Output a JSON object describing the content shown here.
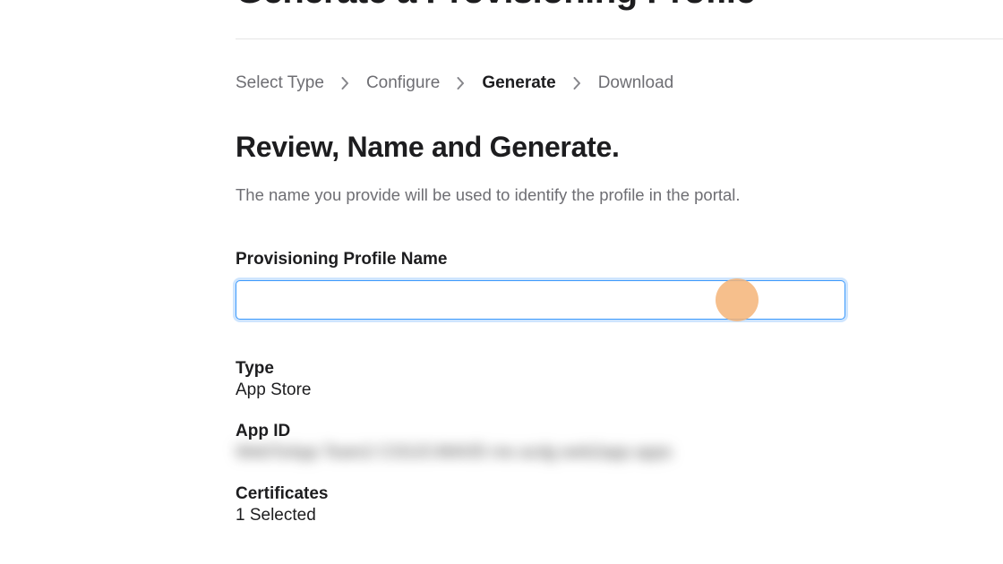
{
  "page": {
    "title": "Generate a Provisioning Profile"
  },
  "breadcrumb": {
    "items": [
      {
        "label": "Select Type",
        "active": false
      },
      {
        "label": "Configure",
        "active": false
      },
      {
        "label": "Generate",
        "active": true
      },
      {
        "label": "Download",
        "active": false
      }
    ]
  },
  "section": {
    "title": "Review, Name and Generate.",
    "description": "The name you provide will be used to identify the profile in the portal."
  },
  "form": {
    "profile_name_label": "Provisioning Profile Name",
    "profile_name_value": ""
  },
  "summary": {
    "type_label": "Type",
    "type_value": "App Store",
    "app_id_label": "App ID",
    "app_id_value": "WebToApp Team2 CSSJC4M435 me acdg web2app apps",
    "certificates_label": "Certificates",
    "certificates_value": "1 Selected"
  }
}
